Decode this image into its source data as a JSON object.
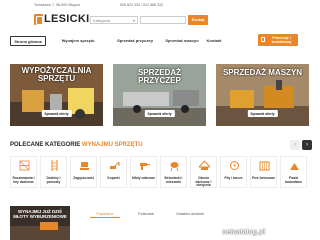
{
  "header": {
    "address": "Tomaszew 7, 96-500 Wiązno",
    "phones": "505 823 332 / 512 888 333",
    "logo_text": "LESICKI",
    "category_select": "Kategoria",
    "search_button": "Szukaj",
    "promo_button": "Promocje i kontaktowy"
  },
  "nav": {
    "items": [
      {
        "label": "Strona główna",
        "active": true
      },
      {
        "label": "Wynajem sprzętu",
        "active": false
      },
      {
        "label": "Sprzedaż przyczep",
        "active": false
      },
      {
        "label": "Sprzedaż maszyn",
        "active": false
      },
      {
        "label": "Kontakt",
        "active": false
      }
    ]
  },
  "heroes": [
    {
      "title": "WYPOŻYCZALNIA SPRZĘTU",
      "cta": "Sprawdź oferty"
    },
    {
      "title": "SPRZEDAŻ PRZYCZEP",
      "cta": "Sprawdź oferty"
    },
    {
      "title": "SPRZEDAŻ MASZYN",
      "cta": "Sprawdź oferty"
    }
  ],
  "categories_section": {
    "title_prefix": "POLECANE KATEGORIE",
    "title_highlight": "WYNAJMU SPRZĘTU",
    "items": [
      {
        "label": "Rusztowania i liny dachowe",
        "icon": "scaffold-icon"
      },
      {
        "label": "Drabiny i pomosty",
        "icon": "ladder-icon"
      },
      {
        "label": "Zagęszczarki",
        "icon": "compactor-icon"
      },
      {
        "label": "Koparki",
        "icon": "excavator-icon"
      },
      {
        "label": "Młoty udarowe",
        "icon": "hammer-drill-icon"
      },
      {
        "label": "Betoniarki i mieszarki",
        "icon": "mixer-icon"
      },
      {
        "label": "Okucia dachowe i zbrojenia",
        "icon": "roof-icon"
      },
      {
        "label": "Piły i tarcze",
        "icon": "saw-icon"
      },
      {
        "label": "Piec betonowe",
        "icon": "heater-icon"
      },
      {
        "label": "Piaski budowlane",
        "icon": "sand-icon"
      }
    ]
  },
  "promo_banner": {
    "text": "WYNAJMIJ JUŻ DZIŚ MŁOTY WYBURZENIOWE"
  },
  "tabs": [
    {
      "label": "Popularne",
      "active": true
    },
    {
      "label": "Polecane",
      "active": false
    },
    {
      "label": "Ostatnio dodane",
      "active": false
    }
  ],
  "watermark": "netcatalog.pl",
  "colors": {
    "accent": "#e8872a",
    "dark": "#222222"
  }
}
